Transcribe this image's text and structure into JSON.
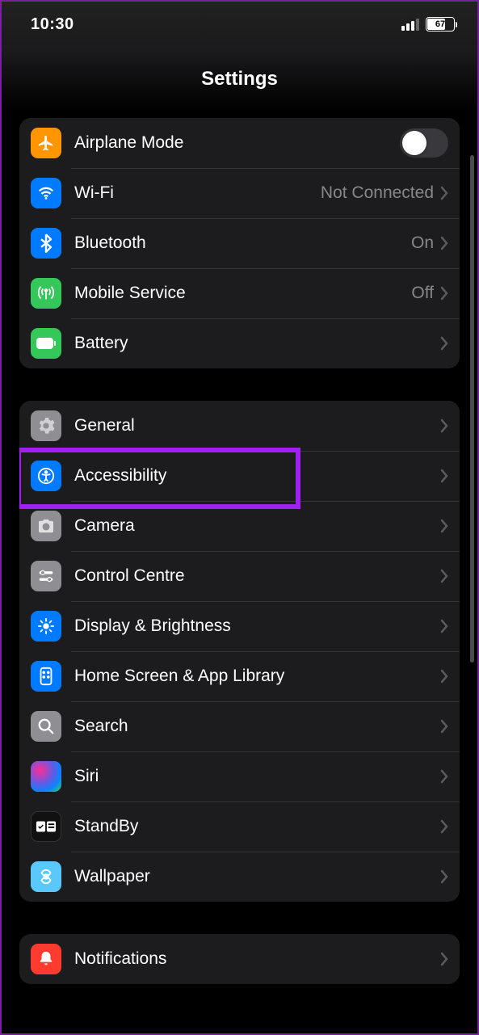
{
  "status": {
    "time": "10:30",
    "battery_pct": "67"
  },
  "header": {
    "title": "Settings"
  },
  "group1": {
    "airplane": "Airplane Mode",
    "wifi": "Wi-Fi",
    "wifi_value": "Not Connected",
    "bluetooth": "Bluetooth",
    "bluetooth_value": "On",
    "mobile": "Mobile Service",
    "mobile_value": "Off",
    "battery": "Battery"
  },
  "group2": {
    "general": "General",
    "accessibility": "Accessibility",
    "camera": "Camera",
    "control_centre": "Control Centre",
    "display_brightness": "Display & Brightness",
    "home_screen": "Home Screen & App Library",
    "search": "Search",
    "siri": "Siri",
    "standby": "StandBy",
    "wallpaper": "Wallpaper"
  },
  "group3": {
    "notifications": "Notifications"
  }
}
